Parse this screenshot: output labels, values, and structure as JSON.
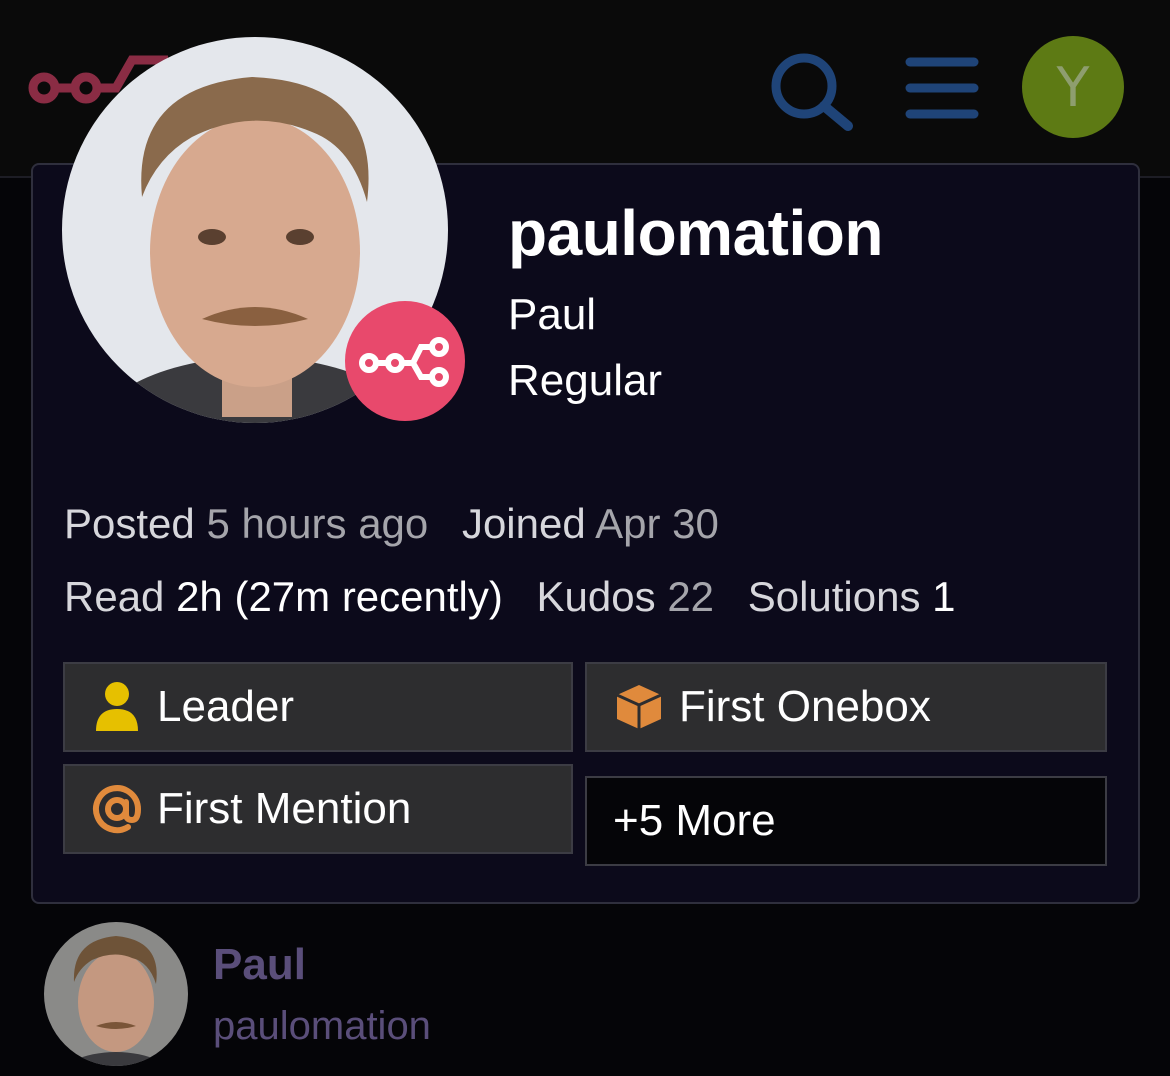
{
  "header": {
    "logo_icon": "n8n-logo-icon",
    "search_icon": "search-icon",
    "menu_icon": "hamburger-menu-icon",
    "user_initial": "Y",
    "colors": {
      "logo": "#8a2c44",
      "icons": "#1f4478",
      "user_avatar": "#5d7a14"
    }
  },
  "card": {
    "username": "paulomation",
    "real_name": "Paul",
    "user_title": "Regular",
    "avatar_badge_icon": "n8n-flair-icon",
    "badge_color": "#e8496c",
    "stats_line1": [
      {
        "label": "Posted",
        "value": "5 hours ago"
      },
      {
        "label": "Joined",
        "value": "Apr 30"
      }
    ],
    "stats_line2": [
      {
        "label": "Read",
        "value": "2h (27m recently)"
      },
      {
        "label": "Kudos",
        "value": "22"
      },
      {
        "label": "Solutions",
        "value": "1"
      }
    ],
    "badges": [
      {
        "label": "Leader",
        "icon": "user-icon",
        "color": "#e6c000"
      },
      {
        "label": "First Onebox",
        "icon": "cube-icon",
        "color": "#e08a3c"
      },
      {
        "label": "First Mention",
        "icon": "at-sign-icon",
        "color": "#e08a3c"
      }
    ],
    "more_label": "+5 More"
  },
  "post": {
    "name": "Paul",
    "username": "paulomation"
  }
}
